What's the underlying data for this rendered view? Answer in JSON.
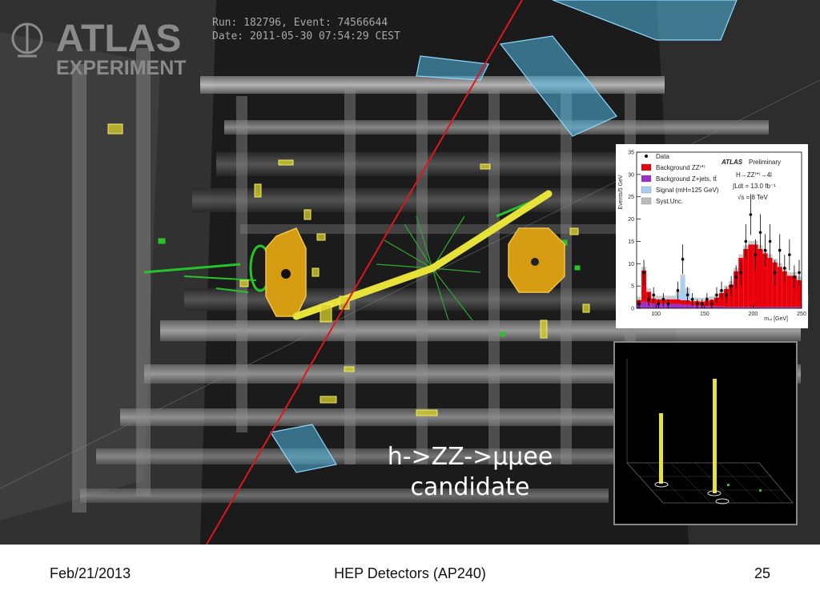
{
  "header": {
    "logo_line1": "ATLAS",
    "logo_line2": "EXPERIMENT",
    "run_line": "Run: 182796, Event: 74566644",
    "date_line": "Date: 2011-05-30 07:54:29 CEST"
  },
  "caption": {
    "line1": "h->ZZ->μμee",
    "line2": "candidate"
  },
  "histogram": {
    "ylabel": "Events/5 GeV",
    "xlabel": "m₄ₗ [GeV]",
    "atlas_bold": "ATLAS",
    "atlas_rest": "Preliminary",
    "process": "H→ZZ⁽*⁾→4l",
    "lumi": "∫Ldt = 13.0 fb⁻¹",
    "energy": "√s = 8 TeV",
    "legend": [
      {
        "label": "Data",
        "color": "#000000"
      },
      {
        "label": "Background ZZ⁽*⁾",
        "color": "#e8000b"
      },
      {
        "label": "Background Z+jets, tt̄",
        "color": "#9b30c8"
      },
      {
        "label": "Signal (mH=125 GeV)",
        "color": "#a8cdf0"
      },
      {
        "label": "Syst.Unc.",
        "color": "#bbbbbb"
      }
    ]
  },
  "chart_data": {
    "type": "bar",
    "x": [
      80,
      85,
      90,
      95,
      100,
      105,
      110,
      115,
      120,
      125,
      130,
      135,
      140,
      145,
      150,
      155,
      160,
      165,
      170,
      175,
      180,
      185,
      190,
      195,
      200,
      205,
      210,
      215,
      220,
      225,
      230,
      235,
      240,
      245
    ],
    "series": [
      {
        "name": "Background ZZ⁽*⁾",
        "values": [
          1,
          7,
          2.5,
          1.2,
          1,
          1,
          1,
          1,
          1,
          1,
          1,
          1,
          1,
          1,
          1.2,
          1.5,
          2,
          3,
          4,
          5,
          8,
          11,
          13,
          14,
          14,
          13,
          12,
          11,
          10,
          9,
          8,
          7,
          7,
          6
        ]
      },
      {
        "name": "Background Z+jets, tt̄",
        "values": [
          0.8,
          1.5,
          1.2,
          1,
          1,
          1,
          1,
          1,
          1,
          0.8,
          0.8,
          0.6,
          0.6,
          0.5,
          0.5,
          0.4,
          0.4,
          0.4,
          0.3,
          0.3,
          0.3,
          0.3,
          0.3,
          0.3,
          0.3,
          0.3,
          0.3,
          0.3,
          0.3,
          0.3,
          0.3,
          0.3,
          0.3,
          0.3
        ]
      },
      {
        "name": "Signal (mH=125 GeV)",
        "values": [
          0,
          0,
          0,
          0,
          0,
          0,
          0,
          0,
          1,
          5,
          2,
          0,
          0,
          0,
          0,
          0,
          0,
          0,
          0,
          0,
          0,
          0,
          0,
          0,
          0,
          0,
          0,
          0,
          0,
          0,
          0,
          0,
          0,
          0
        ]
      },
      {
        "name": "Data",
        "values": [
          1,
          8,
          2,
          3,
          1,
          2,
          1,
          0,
          4,
          11,
          3,
          2,
          1,
          1,
          2,
          1,
          3,
          4,
          3,
          5,
          7,
          8,
          15,
          21,
          12,
          17,
          13,
          15,
          8,
          13,
          9,
          12,
          7,
          8
        ]
      }
    ],
    "xlim": [
      80,
      250
    ],
    "ylim": [
      0,
      35
    ],
    "xticks": [
      100,
      150,
      200,
      250
    ],
    "yticks": [
      0,
      5,
      10,
      15,
      20,
      25,
      30,
      35
    ],
    "xlabel": "m₄ₗ [GeV]",
    "ylabel": "Events/5 GeV"
  },
  "footer": {
    "date": "Feb/21/2013",
    "title": "HEP Detectors (AP240)",
    "page": "25"
  },
  "colors": {
    "track_red": "#e0161a",
    "muon_chamber": "#4fb6e0",
    "calo_yellow": "#e7e23a",
    "endcap_orange": "#d69c12",
    "inner_green": "#26c42a"
  }
}
